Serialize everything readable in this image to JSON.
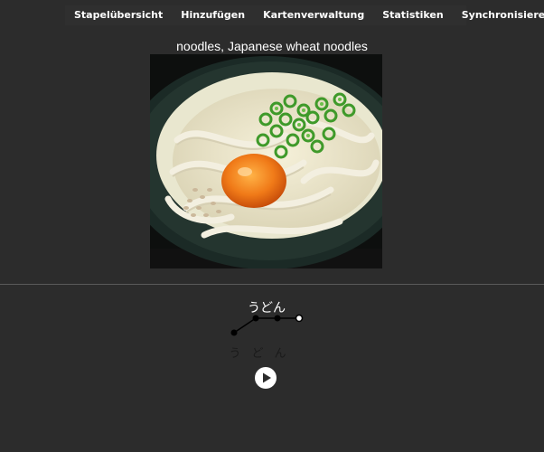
{
  "toolbar": {
    "items": [
      "Stapelübersicht",
      "Hinzufügen",
      "Kartenverwaltung",
      "Statistiken",
      "Synchronisieren"
    ]
  },
  "card": {
    "title": "noodles, Japanese wheat noodles",
    "reading": "うどん",
    "kana": [
      "う",
      "ど",
      "ん"
    ],
    "pitch_pattern": [
      "low",
      "high",
      "high",
      "high"
    ]
  },
  "icons": {
    "play": "play-circle-icon"
  }
}
